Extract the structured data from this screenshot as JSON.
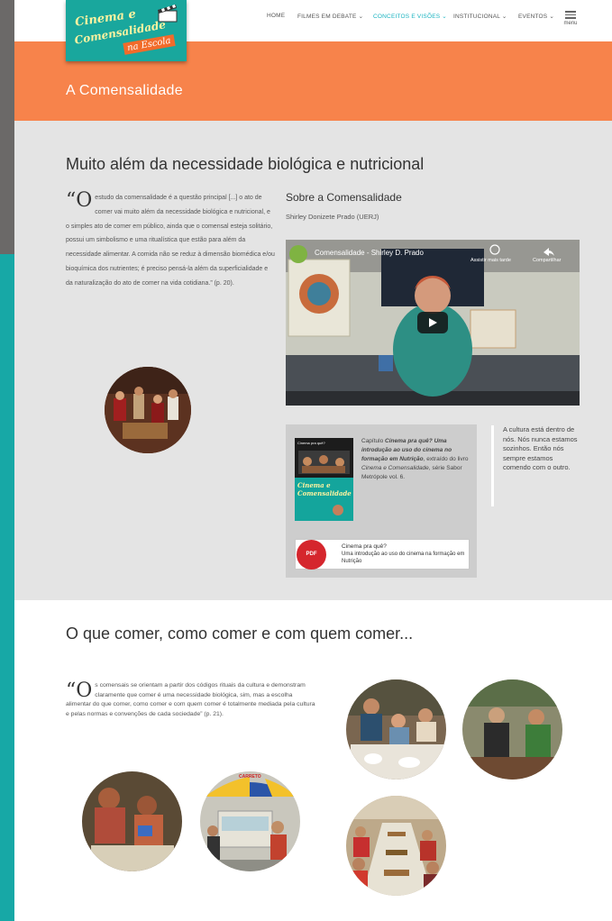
{
  "header": {
    "logo": {
      "line1": "Cinema e",
      "line2": "Comensalidade",
      "line3": "na Escola"
    },
    "nav": [
      {
        "label": "HOME"
      },
      {
        "label": "FILMES EM DEBATE ⌄"
      },
      {
        "label": "CONCEITOS E VISÕES ⌄",
        "active": true
      },
      {
        "label": "INSTITUCIONAL ⌄"
      },
      {
        "label": "EVENTOS ⌄"
      }
    ],
    "menu_label": "menu",
    "accent_color": "#19b3c0"
  },
  "banner": {
    "title": "A Comensalidade",
    "color": "#f7834b"
  },
  "section1": {
    "heading": "Muito além da necessidade biológica e nutricional",
    "quote_mark": "“O",
    "quote": "estudo da comensalidade é a questão principal [...] o ato de comer vai muito além da necessidade biológica e nutricional, e o simples ato de comer em público, ainda que o comensal esteja solitário, possui um simbolismo e uma ritualística que estão para além da necessidade alimentar. A comida não se reduz à dimensão biomédica e/ou bioquímica dos nutrientes; é preciso pensá-la além da superficialidade e da naturalização do ato de comer na vida cotidiana.” (p. 20).",
    "about_title": "Sobre a Comensalidade",
    "about_author": "Shirley Donizete Prado (UERJ)",
    "video": {
      "title": "Comensalidade - Shirley D. Prado",
      "watch_later": "Assistir mais tarde",
      "share": "Compartilhar"
    },
    "book": {
      "cover_top": "Cinema pra quê?",
      "cover_title": "Cinema e Comensalidade",
      "chapter_prefix": "Capítulo ",
      "chapter_title": "Cinema pra quê? Uma introdução ao uso do cinema no formação em Nutrição",
      "extract_text": ", extraído do livro ",
      "book_title": "Cinema e Comensalidade",
      "series": ", série Sabor Metrópole vol. 6."
    },
    "pdf": {
      "icon_label": "PDF",
      "title": "Cinema pra quê?",
      "subtitle": "Uma introdução ao uso do cinema na formação em Nutrição"
    },
    "side_quote": "A cultura está dentro de nós. Nós nunca estamos sozinhos. Então nós sempre estamos comendo com o outro."
  },
  "section2": {
    "heading": "O que comer, como comer e com quem comer...",
    "quote_mark": "“O",
    "quote": "s comensais se orientam a partir dos códigos rituais da cultura e demonstram claramente que comer é uma necessidade biológica, sim, mas a escolha alimentar do que comer, como comer e com quem comer é totalmente mediada pela cultura e pelas normas e convenções de cada sociedade” (p. 21).",
    "cart_sign": "CARRETO"
  }
}
